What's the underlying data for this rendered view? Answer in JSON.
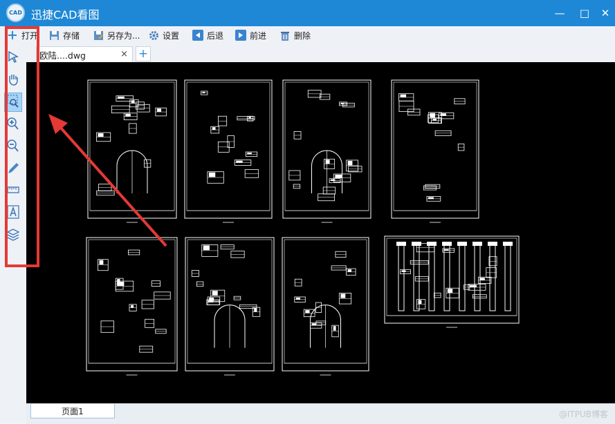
{
  "window": {
    "title": "迅捷CAD看图",
    "logo_text": "CAD",
    "minimize_glyph": "—",
    "maximize_glyph": "□",
    "close_glyph": "✕"
  },
  "toolbar": {
    "open_label": "打开",
    "save_label": "存储",
    "save_as_label": "另存为...",
    "settings_label": "设置",
    "back_label": "后退",
    "forward_label": "前进",
    "delete_label": "删除"
  },
  "tabs": {
    "document_label": "欧陆....dwg",
    "close_glyph": "×",
    "new_glyph": "+"
  },
  "sidebar_tools": [
    "pan-select",
    "hand-pan",
    "zoom-window",
    "zoom-in",
    "zoom-out",
    "pencil",
    "measure",
    "text",
    "layers"
  ],
  "bottom": {
    "page_tab_label": "页面1",
    "watermark": "@ITPUB博客"
  },
  "colors": {
    "titlebar": "#1e88d6",
    "canvas": "#000000",
    "drawing_lines": "#ffffff",
    "highlight_box": "#e53935",
    "active_tool": "#a8d3f5"
  }
}
